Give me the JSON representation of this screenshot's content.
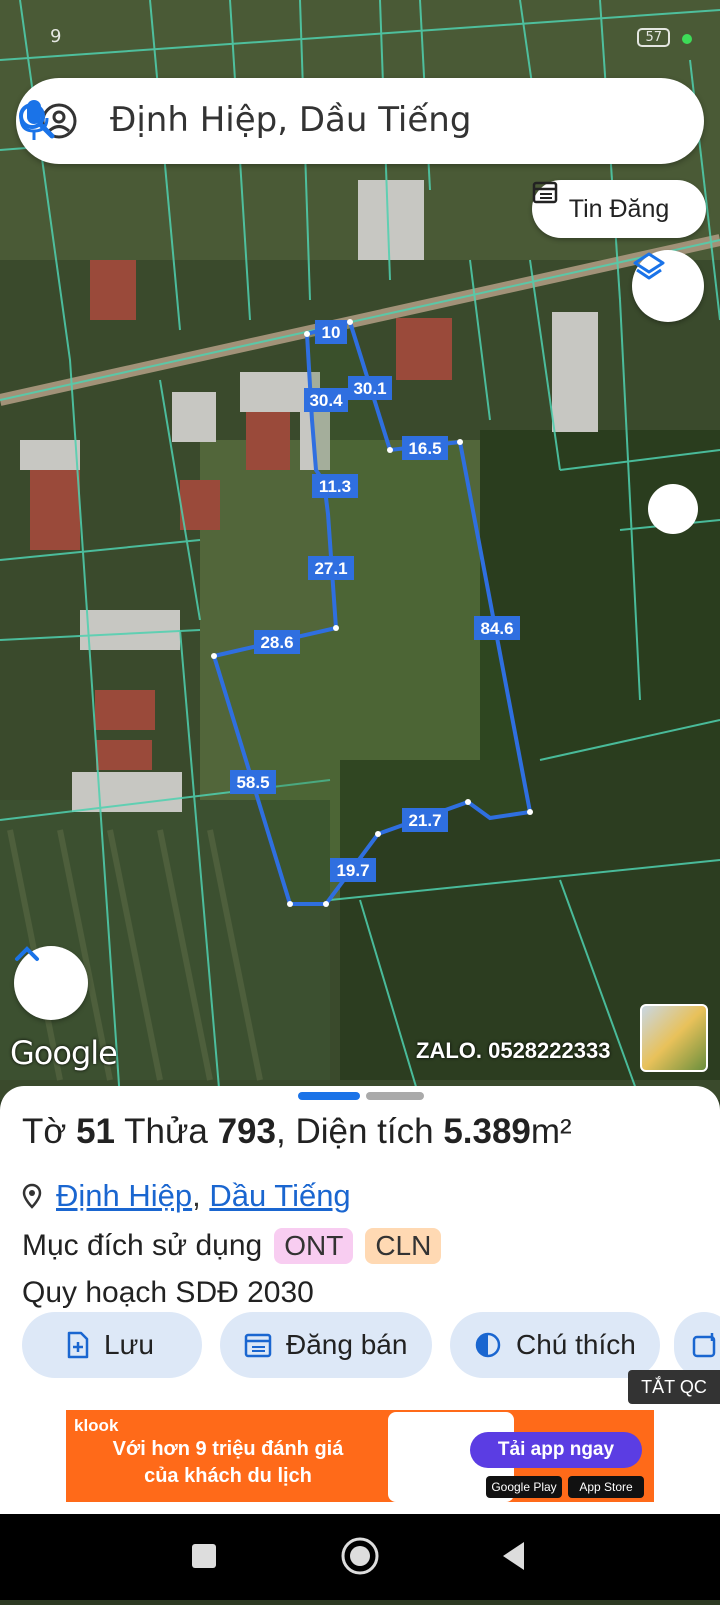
{
  "status": {
    "time": "9",
    "battery": "57"
  },
  "search": {
    "query": "Định Hiệp, Dầu Tiếng"
  },
  "map": {
    "post_button": "Tin Đăng",
    "google_logo": "Google",
    "watermark": "ZALO. 0528222333",
    "edge_labels": [
      "10",
      "30.1",
      "30.4",
      "16.5",
      "11.3",
      "27.1",
      "84.6",
      "28.6",
      "58.5",
      "21.7",
      "19.7"
    ],
    "colors": {
      "boundary": "#2f6fe0",
      "parcel_lines": "#4fd1b0"
    }
  },
  "sheet": {
    "sheet_label": "Tờ",
    "sheet_no": "51",
    "plot_label": "Thửa",
    "plot_no": "793",
    "area_label": "Diện tích",
    "area_value": "5.389",
    "area_unit": "m²",
    "commune": "Định Hiệp",
    "district": "Dầu Tiếng",
    "purpose_label": "Mục đích sử dụng",
    "purpose_tags": [
      "ONT",
      "CLN"
    ],
    "planning": "Quy hoạch SDĐ 2030",
    "actions": {
      "save": "Lưu",
      "sell": "Đăng bán",
      "legend": "Chú thích"
    }
  },
  "ad": {
    "close_label": "TẮT QC",
    "brand": "klook",
    "line1": "Với hơn 9 triệu đánh giá",
    "line2": "của khách du lịch",
    "cta": "Tải app ngay",
    "store1": "Google Play",
    "store2": "App Store"
  }
}
